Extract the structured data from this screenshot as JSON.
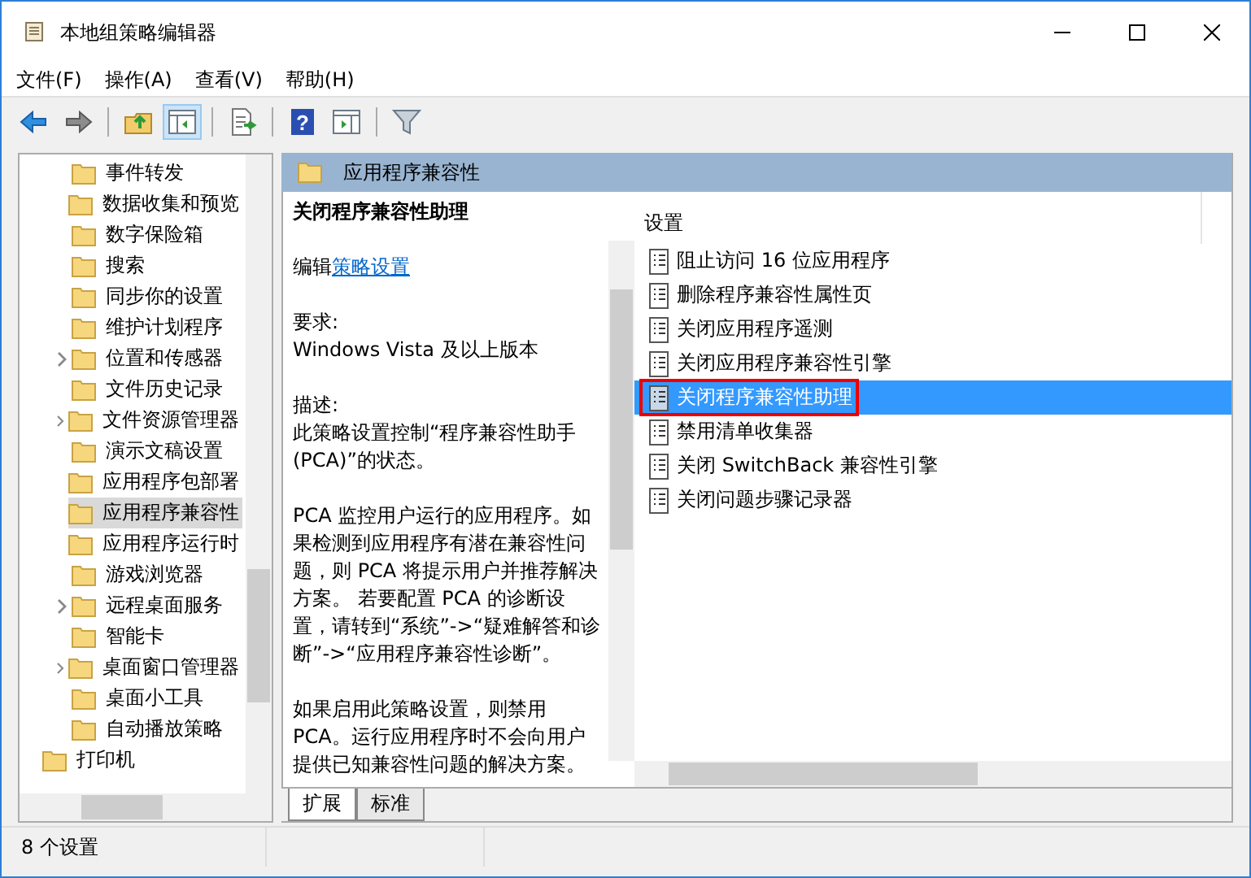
{
  "window": {
    "title": "本地组策略编辑器"
  },
  "menu": [
    "文件(F)",
    "操作(A)",
    "查看(V)",
    "帮助(H)"
  ],
  "toolbar": [
    {
      "kind": "back",
      "pressed": false
    },
    {
      "kind": "forward",
      "pressed": false
    },
    {
      "kind": "sep"
    },
    {
      "kind": "up",
      "pressed": false
    },
    {
      "kind": "pane",
      "pressed": true
    },
    {
      "kind": "sep"
    },
    {
      "kind": "export",
      "pressed": false
    },
    {
      "kind": "sep"
    },
    {
      "kind": "help",
      "pressed": false,
      "glyph": "?"
    },
    {
      "kind": "view",
      "pressed": false
    },
    {
      "kind": "sep"
    },
    {
      "kind": "filter",
      "pressed": false
    }
  ],
  "tree": {
    "items": [
      {
        "children": [
          {
            "label": "事件转发",
            "expandable": false,
            "selected": false
          },
          {
            "label": "数据收集和预览",
            "expandable": false,
            "selected": false
          },
          {
            "label": "数字保险箱",
            "expandable": false,
            "selected": false
          },
          {
            "label": "搜索",
            "expandable": false,
            "selected": false
          },
          {
            "label": "同步你的设置",
            "expandable": false,
            "selected": false
          },
          {
            "label": "维护计划程序",
            "expandable": false,
            "selected": false
          },
          {
            "label": "位置和传感器",
            "expandable": true,
            "selected": false
          },
          {
            "label": "文件历史记录",
            "expandable": false,
            "selected": false
          },
          {
            "label": "文件资源管理器",
            "expandable": true,
            "selected": false
          },
          {
            "label": "演示文稿设置",
            "expandable": false,
            "selected": false
          },
          {
            "label": "应用程序包部署",
            "expandable": false,
            "selected": false
          },
          {
            "label": "应用程序兼容性",
            "expandable": false,
            "selected": true
          },
          {
            "label": "应用程序运行时",
            "expandable": false,
            "selected": false
          },
          {
            "label": "游戏浏览器",
            "expandable": false,
            "selected": false
          },
          {
            "label": "远程桌面服务",
            "expandable": true,
            "selected": false
          },
          {
            "label": "智能卡",
            "expandable": false,
            "selected": false
          },
          {
            "label": "桌面窗口管理器",
            "expandable": true,
            "selected": false
          },
          {
            "label": "桌面小工具",
            "expandable": false,
            "selected": false
          },
          {
            "label": "自动播放策略",
            "expandable": false,
            "selected": false
          }
        ]
      },
      {
        "label": "打印机",
        "expandable": false,
        "selected": false
      }
    ]
  },
  "header": {
    "title": "应用程序兼容性"
  },
  "description": {
    "title": "关闭程序兼容性助理",
    "edit_prefix": "编辑",
    "edit_link": "策略设置",
    "requirements_label": "要求:",
    "requirements": "Windows Vista 及以上版本",
    "description_label": "描述:",
    "paragraphs": [
      "此策略设置控制“程序兼容性助手(PCA)”的状态。",
      "PCA 监控用户运行的应用程序。如果检测到应用程序有潜在兼容性问题，则 PCA 将提示用户并推荐解决方案。 若要配置 PCA 的诊断设置，请转到“系统”->“疑难解答和诊断”->“应用程序兼容性诊断”。",
      "如果启用此策略设置，则禁用 PCA。运行应用程序时不会向用户提供已知兼容性问题的解决方案。"
    ]
  },
  "settings": {
    "column": "设置",
    "items": [
      {
        "label": "阻止访问 16 位应用程序",
        "selected": false,
        "outlined": false
      },
      {
        "label": "删除程序兼容性属性页",
        "selected": false,
        "outlined": false
      },
      {
        "label": "关闭应用程序遥测",
        "selected": false,
        "outlined": false
      },
      {
        "label": "关闭应用程序兼容性引擎",
        "selected": false,
        "outlined": false
      },
      {
        "label": "关闭程序兼容性助理",
        "selected": true,
        "outlined": true
      },
      {
        "label": "禁用清单收集器",
        "selected": false,
        "outlined": false
      },
      {
        "label": "关闭 SwitchBack 兼容性引擎",
        "selected": false,
        "outlined": false
      },
      {
        "label": "关闭问题步骤记录器",
        "selected": false,
        "outlined": false
      }
    ]
  },
  "tabs": [
    {
      "label": "扩展",
      "selected": true
    },
    {
      "label": "标准",
      "selected": false
    }
  ],
  "status_bar": "8 个设置"
}
